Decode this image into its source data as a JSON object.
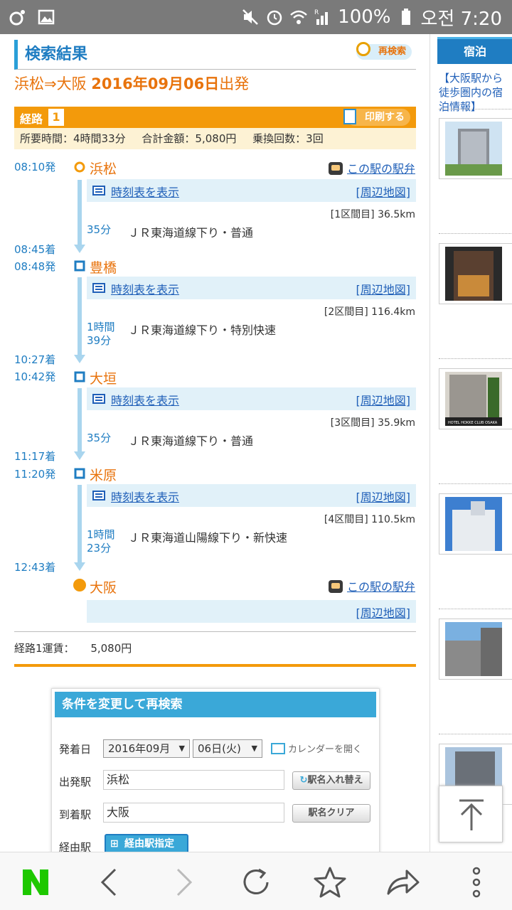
{
  "status": {
    "battery": "100%",
    "time": "오전 7:20",
    "signal_label": "R"
  },
  "header": {
    "title": "検索結果",
    "research_label": "再検索"
  },
  "route": {
    "title_from_to": "浜松⇒大阪",
    "title_date": "2016年09月06日",
    "title_suffix": "出発",
    "label": "経路",
    "number": "1",
    "print_label": "印刷する",
    "summary": {
      "time": "所要時間：4時間33分",
      "fare": "合計金額：5,080円",
      "transfers": "乗換回数：3回"
    }
  },
  "stops": [
    {
      "dep": "08:10発",
      "name": "浜松",
      "bento": "この駅の駅弁"
    },
    {
      "arr": "08:45着",
      "dep": "08:48発",
      "name": "豊橋"
    },
    {
      "arr": "10:27着",
      "dep": "10:42発",
      "name": "大垣"
    },
    {
      "arr": "11:17着",
      "dep": "11:20発",
      "name": "米原"
    },
    {
      "arr": "12:43着",
      "name": "大阪",
      "bento": "この駅の駅弁"
    }
  ],
  "legs": [
    {
      "timetable": "時刻表を表示",
      "map": "[周辺地図]",
      "dist": "[1区間目] 36.5km",
      "dur1": "35分",
      "dur2": "",
      "line": "ＪＲ東海道線下り・普通"
    },
    {
      "timetable": "時刻表を表示",
      "map": "[周辺地図]",
      "dist": "[2区間目] 116.4km",
      "dur1": "1時間",
      "dur2": "39分",
      "line": "ＪＲ東海道線下り・特別快速"
    },
    {
      "timetable": "時刻表を表示",
      "map": "[周辺地図]",
      "dist": "[3区間目] 35.9km",
      "dur1": "35分",
      "dur2": "",
      "line": "ＪＲ東海道線下り・普通"
    },
    {
      "timetable": "時刻表を表示",
      "map": "[周辺地図]",
      "dist": "[4区間目] 110.5km",
      "dur1": "1時間",
      "dur2": "23分",
      "line": "ＪＲ東海道山陽線下り・新快速"
    }
  ],
  "final_map": "[周辺地図]",
  "fare": {
    "label": "経路1運賃：",
    "value": "5,080円"
  },
  "form": {
    "title": "条件を変更して再検索",
    "date_label": "発着日",
    "month": "2016年09月",
    "day": "06日(火)",
    "calendar": "カレンダーを開く",
    "from_label": "出発駅",
    "from_value": "浜松",
    "swap": "駅名入れ替え",
    "to_label": "到着駅",
    "to_value": "大阪",
    "clear": "駅名クリア",
    "via_label": "経由駅",
    "via_btn": "経由駅指定"
  },
  "side": {
    "tab": "宿泊",
    "link": "【大阪駅から徒歩圏内の宿泊情報】",
    "hotel_caption": "HOTEL HOKKE CLUB OSAKA"
  }
}
